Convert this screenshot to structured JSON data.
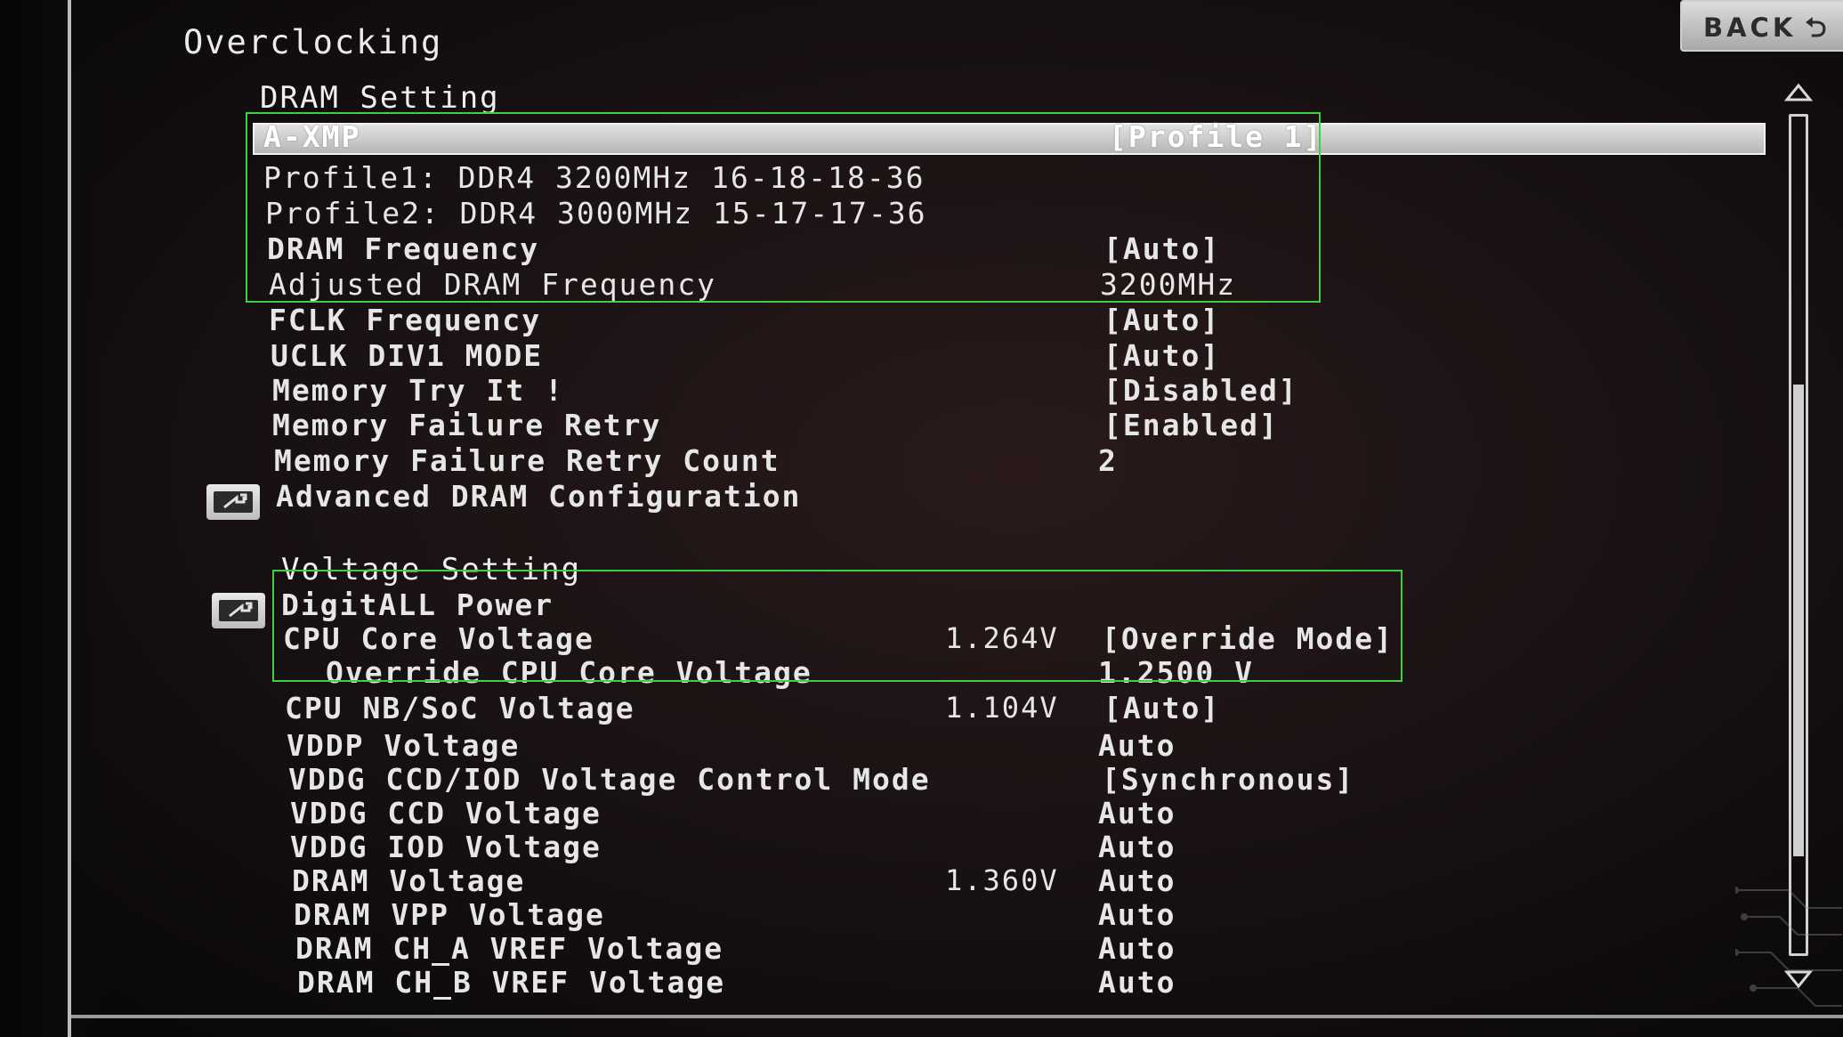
{
  "screen": {
    "title": "Overclocking",
    "back_label": "BACK",
    "back_arrow": "⮌",
    "colors": {
      "selection_box": "#3fcf3f",
      "highlight_bar": "#c8c8c8",
      "text": "#e6e6e6"
    }
  },
  "dram_section": {
    "title": "DRAM Setting",
    "rows": [
      {
        "label": "A-XMP",
        "value": "[Profile 1]",
        "reading": ""
      },
      {
        "label": "Profile1: DDR4 3200MHz 16-18-18-36",
        "value": "",
        "reading": ""
      },
      {
        "label": "Profile2: DDR4 3000MHz 15-17-17-36",
        "value": "",
        "reading": ""
      },
      {
        "label": "DRAM Frequency",
        "value": "[Auto]",
        "reading": ""
      },
      {
        "label": "Adjusted DRAM Frequency",
        "value": "3200MHz",
        "reading": ""
      },
      {
        "label": "FCLK Frequency",
        "value": "[Auto]",
        "reading": ""
      },
      {
        "label": "UCLK DIV1 MODE",
        "value": "[Auto]",
        "reading": ""
      },
      {
        "label": "Memory Try It !",
        "value": "[Disabled]",
        "reading": ""
      },
      {
        "label": "Memory Failure Retry",
        "value": "[Enabled]",
        "reading": ""
      },
      {
        "label": "Memory Failure Retry Count",
        "value": "2",
        "reading": ""
      },
      {
        "label": "Advanced DRAM Configuration",
        "value": "",
        "reading": ""
      }
    ]
  },
  "voltage_section": {
    "title": "Voltage Setting",
    "rows": [
      {
        "label": "DigitALL Power",
        "value": "",
        "reading": ""
      },
      {
        "label": "CPU Core Voltage",
        "value": "[Override Mode]",
        "reading": "1.264V"
      },
      {
        "label": "Override CPU Core Voltage",
        "value": "1.2500 V",
        "reading": ""
      },
      {
        "label": "CPU NB/SoC Voltage",
        "value": "[Auto]",
        "reading": "1.104V"
      },
      {
        "label": "VDDP Voltage",
        "value": "Auto",
        "reading": ""
      },
      {
        "label": "VDDG CCD/IOD Voltage Control Mode",
        "value": "[Synchronous]",
        "reading": ""
      },
      {
        "label": "VDDG CCD Voltage",
        "value": "Auto",
        "reading": ""
      },
      {
        "label": "VDDG IOD Voltage",
        "value": "Auto",
        "reading": ""
      },
      {
        "label": "DRAM Voltage",
        "value": "Auto",
        "reading": "1.360V"
      },
      {
        "label": "DRAM VPP Voltage",
        "value": "Auto",
        "reading": ""
      },
      {
        "label": "DRAM CH_A VREF Voltage",
        "value": "Auto",
        "reading": ""
      },
      {
        "label": "DRAM CH_B VREF Voltage",
        "value": "Auto",
        "reading": ""
      }
    ]
  },
  "icons": {
    "submenu": "submenu-arrow-icon",
    "scroll_up": "chevron-up-icon",
    "scroll_down": "chevron-down-icon"
  }
}
